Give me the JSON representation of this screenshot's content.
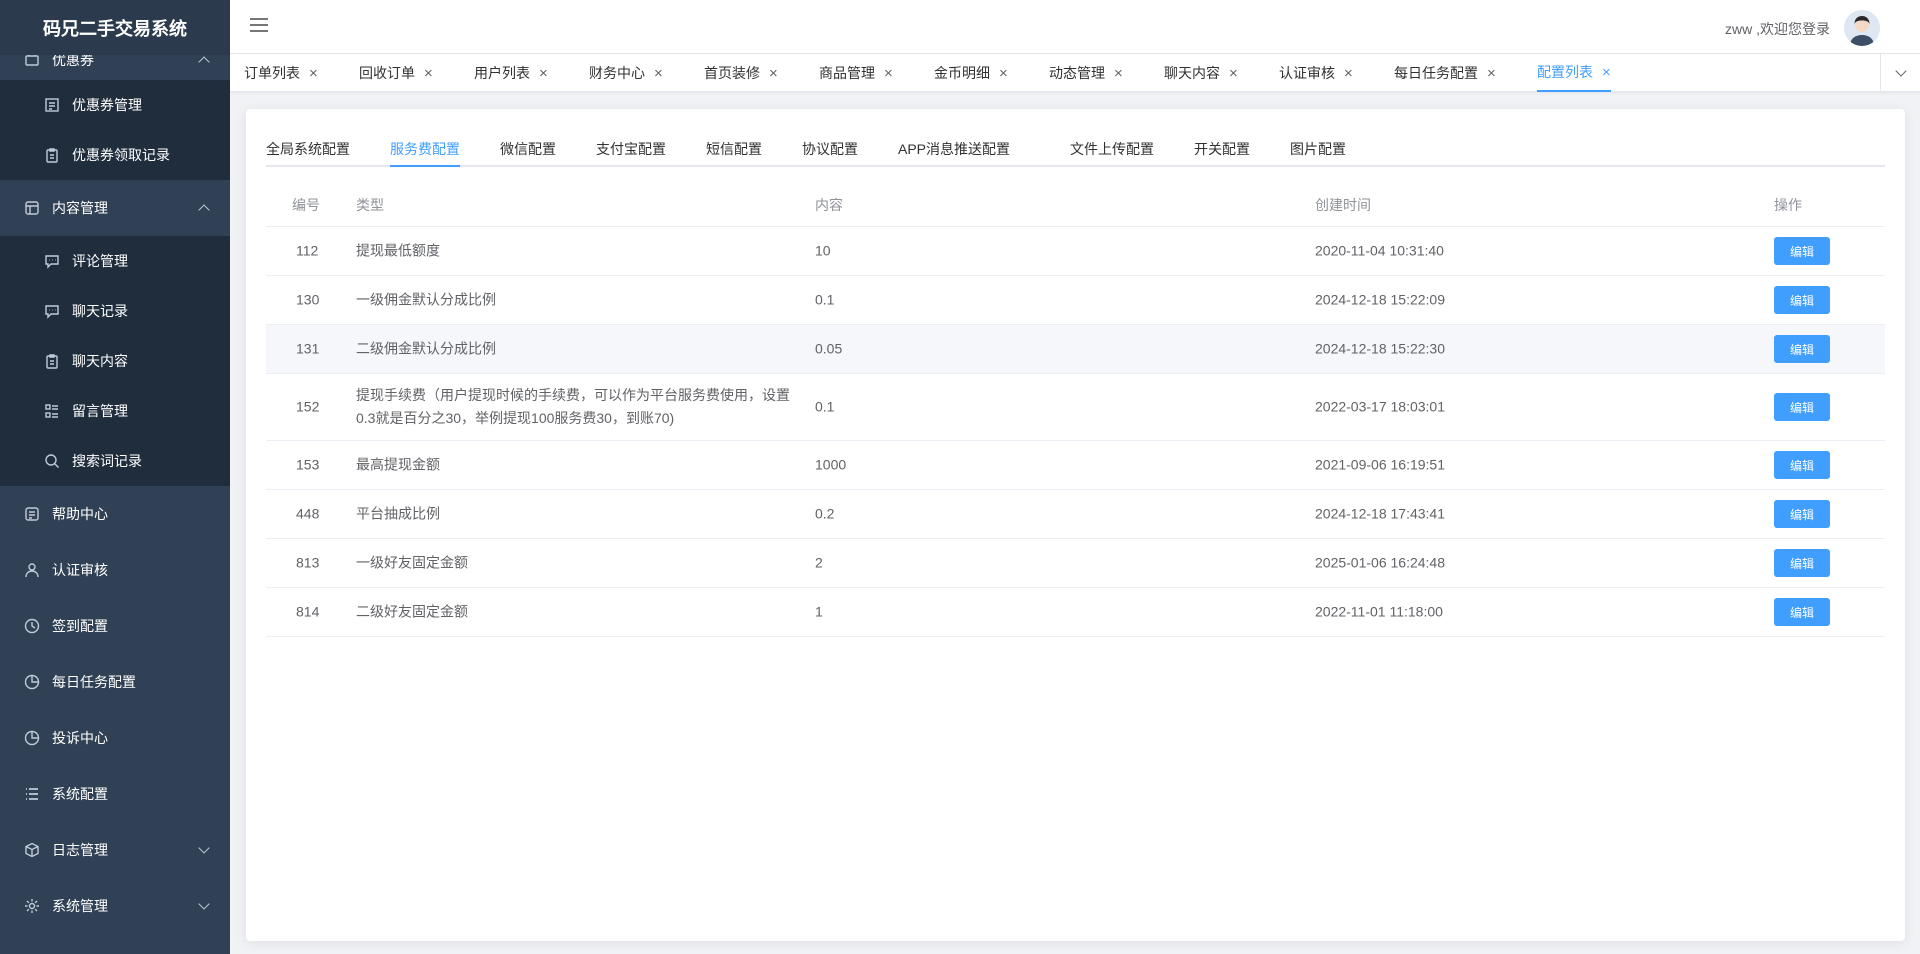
{
  "app": {
    "title": "码兄二手交易系统"
  },
  "header": {
    "user_greeting": "zww ,欢迎您登录",
    "menu_icon": "hamburger-icon",
    "avatar_icon": "avatar"
  },
  "sidebar": {
    "items": [
      {
        "label": "优惠券",
        "icon": "coupon-icon",
        "expanded": true
      },
      {
        "label": "优惠券管理",
        "icon": "list-icon",
        "sub": true
      },
      {
        "label": "优惠券领取记录",
        "icon": "clipboard-icon",
        "sub": true
      },
      {
        "label": "内容管理",
        "icon": "grid-icon",
        "expanded": true
      },
      {
        "label": "评论管理",
        "icon": "chat-icon",
        "sub": true
      },
      {
        "label": "聊天记录",
        "icon": "chat-icon",
        "sub": true
      },
      {
        "label": "聊天内容",
        "icon": "clipboard-icon",
        "sub": true
      },
      {
        "label": "留言管理",
        "icon": "message-list-icon",
        "sub": true
      },
      {
        "label": "搜索词记录",
        "icon": "search-icon",
        "sub": true
      },
      {
        "label": "帮助中心",
        "icon": "help-icon"
      },
      {
        "label": "认证审核",
        "icon": "user-icon"
      },
      {
        "label": "签到配置",
        "icon": "clock-icon"
      },
      {
        "label": "每日任务配置",
        "icon": "pie-icon"
      },
      {
        "label": "投诉中心",
        "icon": "pie-icon"
      },
      {
        "label": "系统配置",
        "icon": "list-lines-icon"
      },
      {
        "label": "日志管理",
        "icon": "box-icon",
        "expanded": false
      },
      {
        "label": "系统管理",
        "icon": "gear-icon",
        "expanded": false
      }
    ]
  },
  "tags": [
    {
      "label": "订单列表"
    },
    {
      "label": "回收订单"
    },
    {
      "label": "用户列表"
    },
    {
      "label": "财务中心"
    },
    {
      "label": "首页装修"
    },
    {
      "label": "商品管理"
    },
    {
      "label": "金币明细"
    },
    {
      "label": "动态管理"
    },
    {
      "label": "聊天内容"
    },
    {
      "label": "认证审核"
    },
    {
      "label": "每日任务配置"
    },
    {
      "label": "配置列表",
      "active": true
    }
  ],
  "subtabs": [
    {
      "label": "全局系统配置"
    },
    {
      "label": "服务费配置",
      "active": true
    },
    {
      "label": "微信配置"
    },
    {
      "label": "支付宝配置"
    },
    {
      "label": "短信配置"
    },
    {
      "label": "协议配置"
    },
    {
      "label": "APP消息推送配置"
    },
    {
      "label": "文件上传配置"
    },
    {
      "label": "开关配置"
    },
    {
      "label": "图片配置"
    }
  ],
  "table": {
    "columns": [
      "编号",
      "类型",
      "内容",
      "创建时间",
      "操作"
    ],
    "edit_label": "编辑",
    "rows": [
      {
        "id": "112",
        "type": "提现最低额度",
        "content": "10",
        "created": "2020-11-04 10:31:40"
      },
      {
        "id": "130",
        "type": "一级佣金默认分成比例",
        "content": "0.1",
        "created": "2024-12-18 15:22:09"
      },
      {
        "id": "131",
        "type": "二级佣金默认分成比例",
        "content": "0.05",
        "created": "2024-12-18 15:22:30"
      },
      {
        "id": "152",
        "type": "提现手续费（用户提现时候的手续费，可以作为平台服务费使用，设置0.3就是百分之30，举例提现100服务费30，到账70)",
        "content": "0.1",
        "created": "2022-03-17 18:03:01"
      },
      {
        "id": "153",
        "type": "最高提现金额",
        "content": "1000",
        "created": "2021-09-06 16:19:51"
      },
      {
        "id": "448",
        "type": "平台抽成比例",
        "content": "0.2",
        "created": "2024-12-18 17:43:41"
      },
      {
        "id": "813",
        "type": "一级好友固定金额",
        "content": "2",
        "created": "2025-01-06 16:24:48"
      },
      {
        "id": "814",
        "type": "二级好友固定金额",
        "content": "1",
        "created": "2022-11-01 11:18:00"
      }
    ]
  },
  "colors": {
    "primary": "#409eff",
    "sidebar_bg": "#304156",
    "submenu_bg": "#1f2d3d"
  }
}
